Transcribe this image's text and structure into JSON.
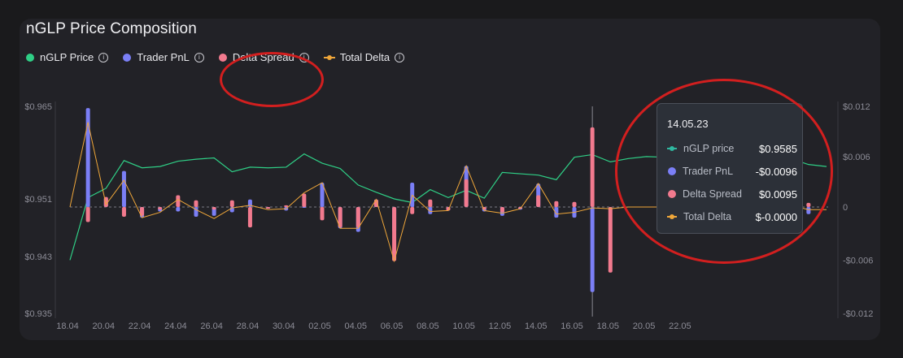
{
  "card": {
    "title": "nGLP Price Composition"
  },
  "legend": [
    {
      "label": "nGLP Price",
      "marker": "dot",
      "color": "#2fcf86",
      "icon": "info-icon"
    },
    {
      "label": "Trader PnL",
      "marker": "dot",
      "color": "#7b7ff6",
      "icon": "info-icon"
    },
    {
      "label": "Delta Spread",
      "marker": "dot",
      "color": "#f27a8e",
      "icon": "info-icon"
    },
    {
      "label": "Total Delta",
      "marker": "line",
      "color": "#f0a73a",
      "icon": "info-icon"
    }
  ],
  "tooltip": {
    "date": "14.05.23",
    "rows": [
      {
        "label": "nGLP price",
        "value": "$0.9585",
        "color": "#2fb8a0",
        "marker": "line"
      },
      {
        "label": "Trader PnL",
        "value": "-$0.0096",
        "color": "#7b7ff6",
        "marker": "dot"
      },
      {
        "label": "Delta Spread",
        "value": "$0.0095",
        "color": "#f27a8e",
        "marker": "dot"
      },
      {
        "label": "Total Delta",
        "value": "$-0.0000",
        "color": "#f0a73a",
        "marker": "line"
      }
    ]
  },
  "chart_data": {
    "type": "bar+line",
    "x_tick_labels": [
      "18.04",
      "20.04",
      "22.04",
      "24.04",
      "26.04",
      "28.04",
      "30.04",
      "02.05",
      "04.05",
      "06.05",
      "08.05",
      "10.05",
      "12.05",
      "14.05",
      "16.05",
      "18.05",
      "20.05",
      "22.05"
    ],
    "left_axis": {
      "ticks": [
        "$0.965",
        "$0.951",
        "$0.943",
        "$0.935"
      ],
      "values": [
        0.965,
        0.951,
        0.943,
        0.935
      ],
      "ylim": [
        0.935,
        0.965
      ]
    },
    "right_axis": {
      "ticks": [
        "$0.012",
        "$0.006",
        "0",
        "-$0.006",
        "-$0.012"
      ],
      "values": [
        0.012,
        0.006,
        0,
        -0.006,
        -0.012
      ],
      "ylim": [
        -0.012,
        0.012
      ]
    },
    "series": [
      {
        "name": "nGLP Price",
        "axis": "left",
        "kind": "line",
        "color": "#2fcf86",
        "values": [
          0.9425,
          0.9512,
          0.9526,
          0.9568,
          0.9557,
          0.9559,
          0.9567,
          0.957,
          0.9572,
          0.9551,
          0.9558,
          0.9557,
          0.9558,
          0.9578,
          0.9564,
          0.9556,
          0.9531,
          0.952,
          0.951,
          0.9505,
          0.9524,
          0.9512,
          0.9523,
          0.9511,
          0.955,
          0.9548,
          0.9546,
          0.9539,
          0.9573,
          0.9577,
          0.9566,
          0.9571,
          0.9574,
          0.9573,
          0.9585,
          0.9585,
          0.9585,
          0.9589,
          0.958,
          0.9576,
          0.9571,
          0.9562,
          0.9559
        ]
      },
      {
        "name": "Trader PnL",
        "axis": "right",
        "kind": "bar",
        "color": "#7b7ff6",
        "values": [
          0,
          0.0118,
          0.0011,
          0.0043,
          -0.0012,
          -0.0005,
          -0.0005,
          -0.0011,
          -0.001,
          -0.0006,
          0.0009,
          -0.0002,
          -0.0004,
          0.0001,
          0.0029,
          -0.0024,
          -0.0028,
          0.0009,
          -0.0028,
          0.0029,
          -0.0008,
          -0.0004,
          0.0049,
          -0.0005,
          -0.001,
          -0.0003,
          0.0028,
          -0.0012,
          -0.0012,
          -0.0096,
          0,
          0,
          0,
          0,
          0,
          0,
          0,
          0,
          0,
          0,
          0.002,
          -0.0008,
          0
        ]
      },
      {
        "name": "Delta Spread",
        "axis": "right",
        "kind": "bar",
        "color": "#f27a8e",
        "values": [
          0,
          -0.0017,
          0.0012,
          -0.0011,
          -0.001,
          -0.0003,
          0.0014,
          0.0008,
          -0.0003,
          0.0008,
          -0.0023,
          -0.0001,
          0.0002,
          0.0016,
          -0.0015,
          -0.0023,
          -0.0023,
          0.0009,
          -0.0061,
          -0.0008,
          0.0009,
          -0.0004,
          0.0033,
          -0.0003,
          -0.0006,
          -0.0001,
          0.0014,
          0.0007,
          0.0006,
          0.0095,
          -0.0074,
          0,
          0,
          0,
          0,
          0,
          0,
          0,
          0,
          0,
          -0.0018,
          0.0005,
          0
        ]
      },
      {
        "name": "Total Delta",
        "axis": "right",
        "kind": "line",
        "color": "#f0a73a",
        "values": [
          0,
          0.0101,
          0.0003,
          0.0032,
          -0.0012,
          -0.0006,
          0.0009,
          -0.0003,
          -0.0013,
          -0.0001,
          0.0002,
          -0.0003,
          -0.0002,
          0.0017,
          0.0029,
          -0.0024,
          -0.0024,
          0.0009,
          -0.0061,
          0.0014,
          -0.0005,
          -0.0004,
          0.0049,
          -0.0004,
          -0.0007,
          -0.0002,
          0.0028,
          -0.0008,
          -0.0006,
          -0.0001,
          -0.0002,
          0,
          0,
          0,
          0,
          0,
          0,
          0,
          0,
          0,
          0.0002,
          -0.0003,
          -0.0003
        ]
      }
    ],
    "hover_index": 29,
    "baseline": 0,
    "grid": false
  }
}
